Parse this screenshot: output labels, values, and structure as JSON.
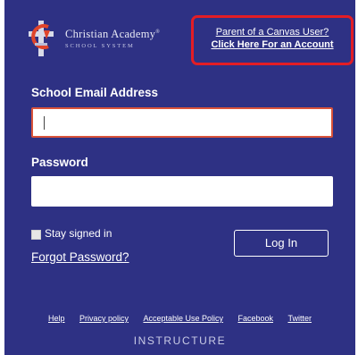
{
  "header": {
    "logo": {
      "name": "Christian Academy",
      "trademark": "®",
      "subtitle": "SCHOOL SYSTEM",
      "icon": "cross-crest-icon"
    },
    "parent_link": {
      "line1": "Parent of a Canvas User?",
      "line2": "Click Here For an Account"
    }
  },
  "form": {
    "email_label": "School Email Address",
    "email_value": "",
    "password_label": "Password",
    "password_value": "",
    "stay_signed_in": "Stay signed in",
    "stay_checked": false,
    "forgot": "Forgot Password?",
    "login_button": "Log In"
  },
  "footer": {
    "links": [
      "Help",
      "Privacy policy",
      "Acceptable Use Policy",
      "Facebook",
      "Twitter"
    ],
    "brand": "INSTRUCTURE"
  },
  "colors": {
    "background": "#2e3184",
    "highlight_border": "#e31d25",
    "email_field_border": "#d9533a"
  }
}
